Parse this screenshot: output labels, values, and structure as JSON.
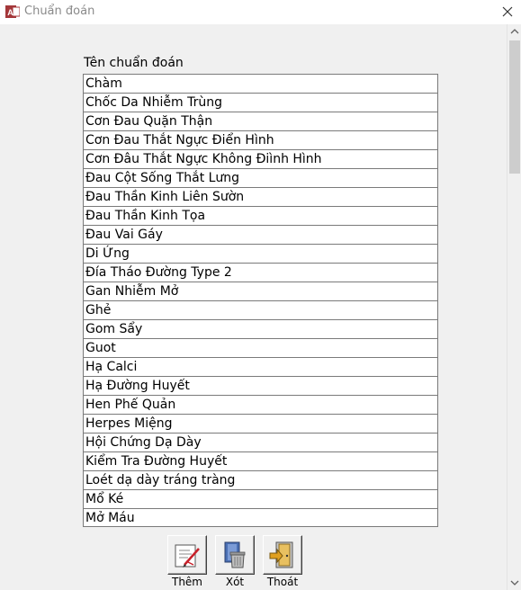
{
  "window": {
    "title": "Chuẩn đoán",
    "app_icon": "access-app-icon",
    "close_icon": "close-icon"
  },
  "list": {
    "label": "Tên chuẩn đoán",
    "items": [
      "Chàm",
      "Chốc Da Nhiễm Trùng",
      "Cơn Đau Quặn Thận",
      "Cơn Đau Thắt Ngực Điển Hình",
      "Cơn Đâu Thắt Ngực Không Điình Hình",
      "Đau Cột Sống Thắt Lưng",
      "Đau Thần Kinh Liên Sườn",
      "Đau Thần Kinh Tọa",
      "Đau Vai Gáy",
      "Di Ứng",
      "Đía Tháo Đường Type 2",
      "Gan Nhiễm Mở",
      "Ghẻ",
      "Gom Sẩy",
      "Guot",
      "Hạ Calci",
      "Hạ Đường Huyết",
      "Hen Phế Quản",
      "Herpes Miệng",
      "Hội Chứng Dạ Dày",
      "Kiểm Tra Đường Huyết",
      "Loét dạ dày tráng tràng",
      "Mổ Ké",
      "Mở Máu"
    ]
  },
  "toolbar": {
    "add_label": "Thêm",
    "delete_label": "Xót",
    "exit_label": "Thoát",
    "add_icon": "add-document-icon",
    "delete_icon": "trash-icon",
    "exit_icon": "exit-door-icon"
  },
  "colors": {
    "titlebar_bg": "#ffffff",
    "window_bg": "#f0f0f0",
    "list_border": "#7a7a7a",
    "title_text": "#8a8a8a",
    "app_icon_red": "#a4373a"
  }
}
